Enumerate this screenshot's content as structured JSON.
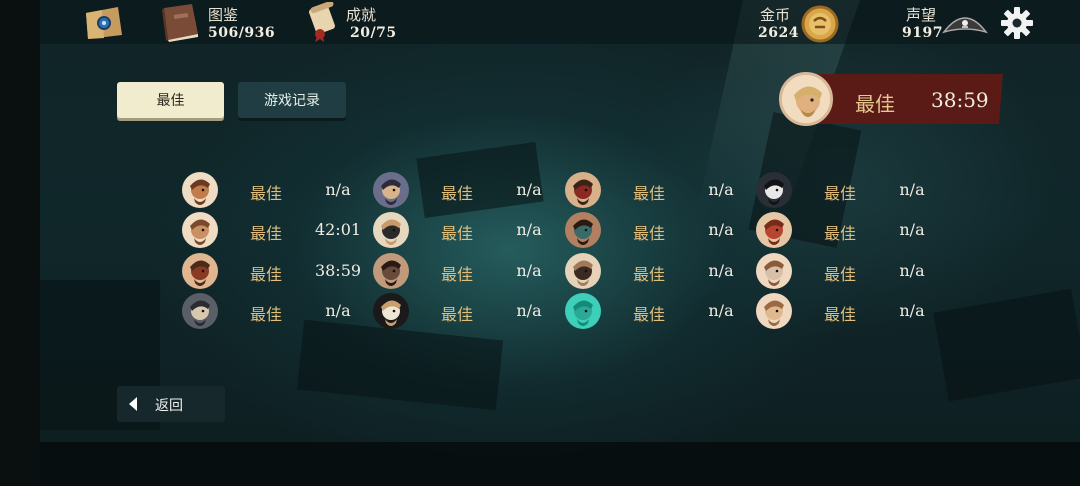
{
  "topbar": {
    "collection": {
      "label": "图鉴",
      "value": "506/936",
      "icon": "book-icon"
    },
    "achievements": {
      "label": "成就",
      "value": "20/75",
      "icon": "scroll-icon"
    },
    "gold": {
      "label": "金币",
      "value": "2624",
      "icon": "coin-icon"
    },
    "reputation": {
      "label": "声望",
      "value": "9197",
      "icon": "pirate-hat-icon"
    },
    "map_icon": "map-icon",
    "settings_icon": "gear-icon"
  },
  "tabs": {
    "best": "最佳",
    "record": "游戏记录"
  },
  "best_badge": {
    "label": "最佳",
    "value": "38:59"
  },
  "grid_label": "最佳",
  "rows": [
    [
      {
        "value": "n/a"
      },
      {
        "value": "n/a"
      },
      {
        "value": "n/a"
      },
      {
        "value": "n/a"
      }
    ],
    [
      {
        "value": "42:01"
      },
      {
        "value": "n/a"
      },
      {
        "value": "n/a"
      },
      {
        "value": "n/a"
      }
    ],
    [
      {
        "value": "38:59"
      },
      {
        "value": "n/a"
      },
      {
        "value": "n/a"
      },
      {
        "value": "n/a"
      }
    ],
    [
      {
        "value": "n/a"
      },
      {
        "value": "n/a"
      },
      {
        "value": "n/a"
      },
      {
        "value": "n/a"
      }
    ]
  ],
  "back": {
    "label": "返回"
  },
  "colors": {
    "accent_label": "#e2bf7c",
    "badge_red": "#5a1a16",
    "tab_active": "#f2eccf",
    "tab_inactive": "#1f3d42"
  }
}
